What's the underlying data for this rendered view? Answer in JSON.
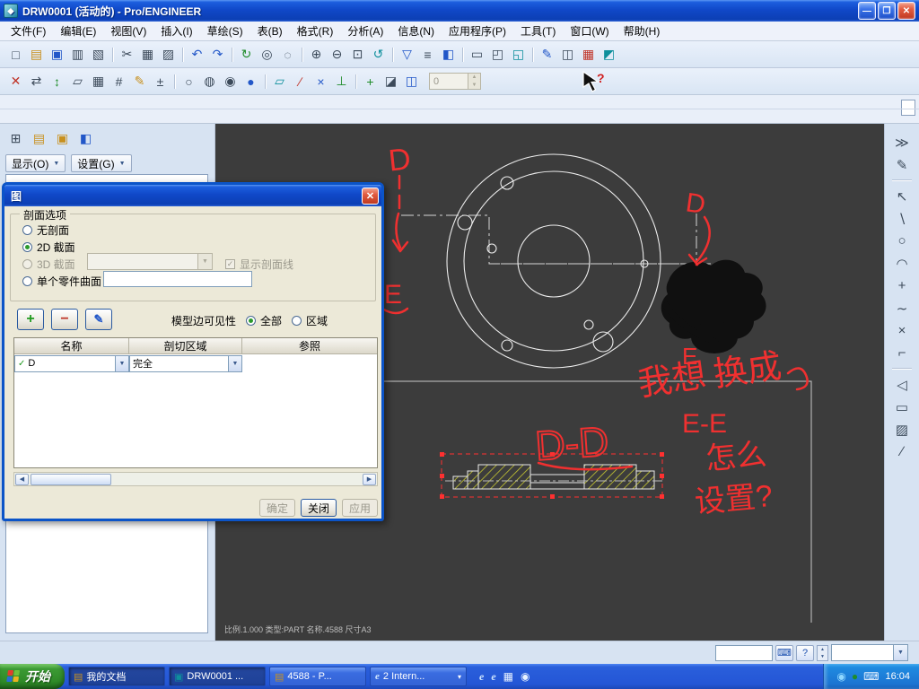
{
  "colors": {
    "titlebar_blue": "#1048c8",
    "canvas_bg": "#3c3c3c",
    "annotation_red": "#f03030",
    "hatch_yellow": "#c8c832",
    "taskbar_blue": "#2a5fdb",
    "start_green": "#3c9a34",
    "panel_blue": "#d7e3f2"
  },
  "window": {
    "title": "DRW0001 (活动的) - Pro/ENGINEER",
    "controls": {
      "minimize": "—",
      "maximize": "❒",
      "close": "✕"
    },
    "app_icon_glyph": "◆"
  },
  "menu": {
    "items": [
      {
        "name": "menu-file",
        "label": "文件(F)"
      },
      {
        "name": "menu-edit",
        "label": "编辑(E)"
      },
      {
        "name": "menu-view",
        "label": "视图(V)"
      },
      {
        "name": "menu-insert",
        "label": "插入(I)"
      },
      {
        "name": "menu-sketch",
        "label": "草绘(S)"
      },
      {
        "name": "menu-table",
        "label": "表(B)"
      },
      {
        "name": "menu-format",
        "label": "格式(R)"
      },
      {
        "name": "menu-analysis",
        "label": "分析(A)"
      },
      {
        "name": "menu-info",
        "label": "信息(N)"
      },
      {
        "name": "menu-applications",
        "label": "应用程序(P)"
      },
      {
        "name": "menu-tools",
        "label": "工具(T)"
      },
      {
        "name": "menu-window",
        "label": "窗口(W)"
      },
      {
        "name": "menu-help",
        "label": "帮助(H)"
      }
    ]
  },
  "toolbar1": {
    "icons": [
      {
        "name": "new-file-icon",
        "glyph": "□"
      },
      {
        "name": "open-file-icon",
        "glyph": "▤",
        "cls": "c-yellow"
      },
      {
        "name": "save-icon",
        "glyph": "▣",
        "cls": "c-blue"
      },
      {
        "name": "print-icon",
        "glyph": "▥"
      },
      {
        "name": "print-preview-icon",
        "glyph": "▧"
      },
      {
        "name": "toolbar-separator",
        "glyph": "",
        "cls": "sep",
        "inter": "false"
      },
      {
        "name": "cut-icon",
        "glyph": "✂"
      },
      {
        "name": "copy-icon",
        "glyph": "▦"
      },
      {
        "name": "paste-icon",
        "glyph": "▨"
      },
      {
        "name": "toolbar-separator",
        "glyph": "",
        "cls": "sep",
        "inter": "false"
      },
      {
        "name": "undo-icon",
        "glyph": "↶",
        "cls": "c-blue"
      },
      {
        "name": "redo-icon",
        "glyph": "↷",
        "cls": "c-blue"
      },
      {
        "name": "toolbar-separator",
        "glyph": "",
        "cls": "sep",
        "inter": "false"
      },
      {
        "name": "regenerate-icon",
        "glyph": "↻",
        "cls": "c-green"
      },
      {
        "name": "search-icon",
        "glyph": "◎"
      },
      {
        "name": "select-box-icon",
        "glyph": "◌"
      },
      {
        "name": "toolbar-separator",
        "glyph": "",
        "cls": "sep",
        "inter": "false"
      },
      {
        "name": "zoom-in-icon",
        "glyph": "⊕"
      },
      {
        "name": "zoom-out-icon",
        "glyph": "⊖"
      },
      {
        "name": "zoom-fit-icon",
        "glyph": "⊡"
      },
      {
        "name": "repaint-icon",
        "glyph": "↺",
        "cls": "c-teal"
      },
      {
        "name": "toolbar-separator",
        "glyph": "",
        "cls": "sep",
        "inter": "false"
      },
      {
        "name": "saved-views-icon",
        "glyph": "▽",
        "cls": "c-blue"
      },
      {
        "name": "layer-icon",
        "glyph": "≡"
      },
      {
        "name": "view-manager-icon",
        "glyph": "◧",
        "cls": "c-blue"
      },
      {
        "name": "toolbar-separator",
        "glyph": "",
        "cls": "sep",
        "inter": "false"
      },
      {
        "name": "window-icon",
        "glyph": "▭"
      },
      {
        "name": "new-window-icon",
        "glyph": "◰"
      },
      {
        "name": "overlay-window-icon",
        "glyph": "◱",
        "cls": "c-teal"
      },
      {
        "name": "toolbar-separator",
        "glyph": "",
        "cls": "sep",
        "inter": "false"
      },
      {
        "name": "sketcher-tools-icon",
        "glyph": "✎",
        "cls": "c-blue"
      },
      {
        "name": "drawing-views-icon",
        "glyph": "◫"
      },
      {
        "name": "table-tools-icon",
        "glyph": "▦",
        "cls": "c-red"
      },
      {
        "name": "format-tools-icon",
        "glyph": "◩",
        "cls": "c-teal"
      }
    ]
  },
  "toolbar2": {
    "icons": [
      {
        "name": "delete-icon",
        "glyph": "✕",
        "cls": "c-red"
      },
      {
        "name": "swap-view-icon",
        "glyph": "⇄"
      },
      {
        "name": "update-sheets-icon",
        "glyph": "↕",
        "cls": "c-green"
      },
      {
        "name": "sheet-setup-icon",
        "glyph": "▱"
      },
      {
        "name": "table-icon",
        "glyph": "▦"
      },
      {
        "name": "grid-icon",
        "glyph": "#"
      },
      {
        "name": "sketch-icon",
        "glyph": "✎",
        "cls": "c-yellow"
      },
      {
        "name": "tolerance-icon",
        "glyph": "±"
      },
      {
        "name": "toolbar-separator",
        "glyph": "",
        "cls": "sep",
        "inter": "false"
      },
      {
        "name": "wireframe-icon",
        "glyph": "○"
      },
      {
        "name": "hidden-line-icon",
        "glyph": "◍"
      },
      {
        "name": "no-hidden-icon",
        "glyph": "◉"
      },
      {
        "name": "shaded-icon",
        "glyph": "●",
        "cls": "c-blue"
      },
      {
        "name": "toolbar-separator",
        "glyph": "",
        "cls": "sep",
        "inter": "false"
      },
      {
        "name": "datum-planes-icon",
        "glyph": "▱",
        "cls": "c-teal"
      },
      {
        "name": "datum-axes-icon",
        "glyph": "∕",
        "cls": "c-red"
      },
      {
        "name": "datum-points-icon",
        "glyph": "×",
        "cls": "c-blue"
      },
      {
        "name": "datum-csys-icon",
        "glyph": "⊥",
        "cls": "c-green"
      },
      {
        "name": "toolbar-separator",
        "glyph": "",
        "cls": "sep",
        "inter": "false"
      },
      {
        "name": "spin-center-icon",
        "glyph": "+",
        "cls": "c-green"
      },
      {
        "name": "orientation-icon",
        "glyph": "◪"
      },
      {
        "name": "model-display-icon",
        "glyph": "◫",
        "cls": "c-blue"
      }
    ],
    "spinner_value": "0"
  },
  "left_panel": {
    "icons": [
      {
        "name": "tree-columns-icon",
        "glyph": "⊞"
      },
      {
        "name": "open-rep-icon",
        "glyph": "▤",
        "cls": "c-yellow"
      },
      {
        "name": "favorites-icon",
        "glyph": "▣",
        "cls": "c-yellow"
      },
      {
        "name": "layer-tree-icon",
        "glyph": "◧",
        "cls": "c-blue"
      }
    ],
    "display_button": "显示(O)",
    "settings_button": "设置(G)",
    "dropdown_arrow": "▼"
  },
  "right_toolbar": {
    "icons": [
      {
        "name": "publish-icon",
        "glyph": "≫",
        "cls": "c-teal"
      },
      {
        "name": "markup-icon",
        "glyph": "✎",
        "cls": "c-red"
      },
      {
        "name": "toolbar-separator",
        "glyph": "",
        "cls": "sep",
        "inter": "false"
      },
      {
        "name": "select-arrow-icon",
        "glyph": "↖"
      },
      {
        "name": "line-tool-icon",
        "glyph": "∖"
      },
      {
        "name": "circle-tool-icon",
        "glyph": "○"
      },
      {
        "name": "arc-tool-icon",
        "glyph": "◠"
      },
      {
        "name": "point-tool-icon",
        "glyph": "+"
      },
      {
        "name": "spline-tool-icon",
        "glyph": "∼"
      },
      {
        "name": "delete-segment-icon",
        "glyph": "×",
        "cls": "c-red"
      },
      {
        "name": "corner-tool-icon",
        "glyph": "⌐"
      },
      {
        "name": "toolbar-separator",
        "glyph": "",
        "cls": "sep",
        "inter": "false"
      },
      {
        "name": "mirror-tool-icon",
        "glyph": "◁"
      },
      {
        "name": "rectangle-tool-icon",
        "glyph": "▭"
      },
      {
        "name": "hatch-tool-icon",
        "glyph": "▨"
      },
      {
        "name": "axis-line-icon",
        "glyph": "∕"
      }
    ]
  },
  "dialog": {
    "title": "图",
    "close_glyph": "✕",
    "section_group_label": "剖面选项",
    "radios": {
      "none": "无剖面",
      "two_d": "2D 截面",
      "three_d": "3D 截面",
      "single_surface": "单个零件曲面"
    },
    "show_hatch_label": "显示剖面线",
    "add_label": "+",
    "remove_label": "−",
    "edit_hatch_glyph": "✎",
    "visibility_label": "模型边可见性",
    "visibility_all": "全部",
    "visibility_area": "区域",
    "table": {
      "headers": [
        "名称",
        "剖切区域",
        "参照"
      ],
      "rows": [
        {
          "check": "✓",
          "name": "D",
          "region": "完全",
          "ref": ""
        }
      ]
    },
    "buttons": {
      "ok": "确定",
      "close": "关闭",
      "apply": "应用"
    }
  },
  "canvas": {
    "status_line": "比例.1.000  类型:PART  名称.4588  尺寸A3",
    "annotations": {
      "d_top": "D",
      "e_left": "E",
      "d_right": "D",
      "e_right": "E",
      "section_label": "D-D",
      "note_w1": "我想",
      "note_w2": "换成",
      "note_e": "E-E",
      "note_line2": "怎么",
      "note_line3": "设置?"
    }
  },
  "cursor": {
    "help_glyph": "?"
  },
  "status_bar": {
    "filter_value": "",
    "keyboard_glyph": "⌨",
    "help_glyph": "?"
  },
  "taskbar": {
    "start_label": "开始",
    "tasks": [
      {
        "name": "task-my-documents",
        "label": "我的文档",
        "icon": "▤",
        "ic": "c-yellow",
        "cls": "pressed",
        "chev": ""
      },
      {
        "name": "task-drw0001",
        "label": "DRW0001 ...",
        "icon": "▣",
        "ic": "c-teal",
        "cls": "pressed",
        "chev": ""
      },
      {
        "name": "task-4588",
        "label": "4588 - P...",
        "icon": "▤",
        "ic": "c-yellow",
        "cls": "",
        "chev": ""
      },
      {
        "name": "task-internet",
        "label": "2 Intern...",
        "icon": "e",
        "ic": "ie",
        "cls": "",
        "chev": "▾"
      }
    ],
    "mid_icons": [
      {
        "name": "ie-icon",
        "glyph": "e",
        "cls": "ie"
      },
      {
        "name": "explorer-icon",
        "glyph": "e",
        "cls": "ie"
      },
      {
        "name": "drive-icon",
        "glyph": "▦",
        "cls": "wh"
      },
      {
        "name": "media-icon",
        "glyph": "◉",
        "cls": "wh"
      }
    ],
    "tray_icons": [
      {
        "name": "messenger-tray-icon",
        "glyph": "◉",
        "cls": "c-skyblue"
      },
      {
        "name": "safety-tray-icon",
        "glyph": "●",
        "cls": "c-green"
      },
      {
        "name": "input-tray-icon",
        "glyph": "⌨",
        "cls": "wh"
      }
    ],
    "time": "16:04"
  }
}
